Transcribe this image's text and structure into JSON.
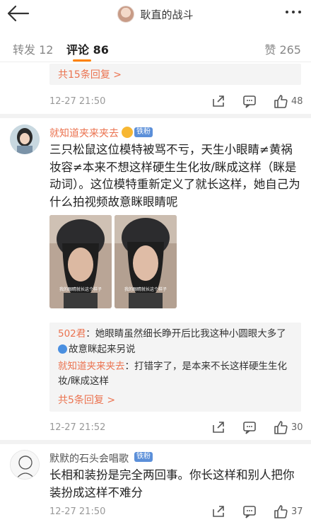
{
  "header": {
    "title": "耿直的战斗"
  },
  "tabs": [
    {
      "label": "转发 12"
    },
    {
      "label": "评论 86"
    },
    {
      "label": "赞 265"
    }
  ],
  "comments": [
    {
      "reply_more": "共15条回复 >",
      "time": "12-27 21:50",
      "likes": "48"
    },
    {
      "username": "就知道夹来夹去",
      "badge": "铁粉",
      "text": "三只松鼠这位模特被骂不亏，天生小眼睛≠黄祸妆容≠本来不想这样硬生生化妆/眯成这样（眯是动词）。这位模特重新定义了就长这样，她自己为什么拍视频故意眯眼睛呢",
      "photo_caption": "我的眼睛就长这个样子",
      "replies": [
        {
          "name": "502君",
          "text": "：她眼睛虽然细长睁开后比我这种小圆眼大多了",
          "text2": "故意眯起来另说"
        },
        {
          "name": "就知道夹来夹去",
          "text": "：打错字了，是本来不长这样硬生生化",
          "text2": "妆/眯成这样"
        }
      ],
      "reply_more": "共5条回复 >",
      "time": "12-27 21:52",
      "likes": "30"
    },
    {
      "username": "默默的石头会唱歌",
      "badge": "铁粉",
      "text": "长相和装扮是完全两回事。你长这样和别人把你装扮成这样不难分",
      "time": "12-27 21:50",
      "likes": "37"
    }
  ],
  "colors": {
    "accent": "#ff8200",
    "link": "#eb7350",
    "badge": "#5b8fd9"
  }
}
